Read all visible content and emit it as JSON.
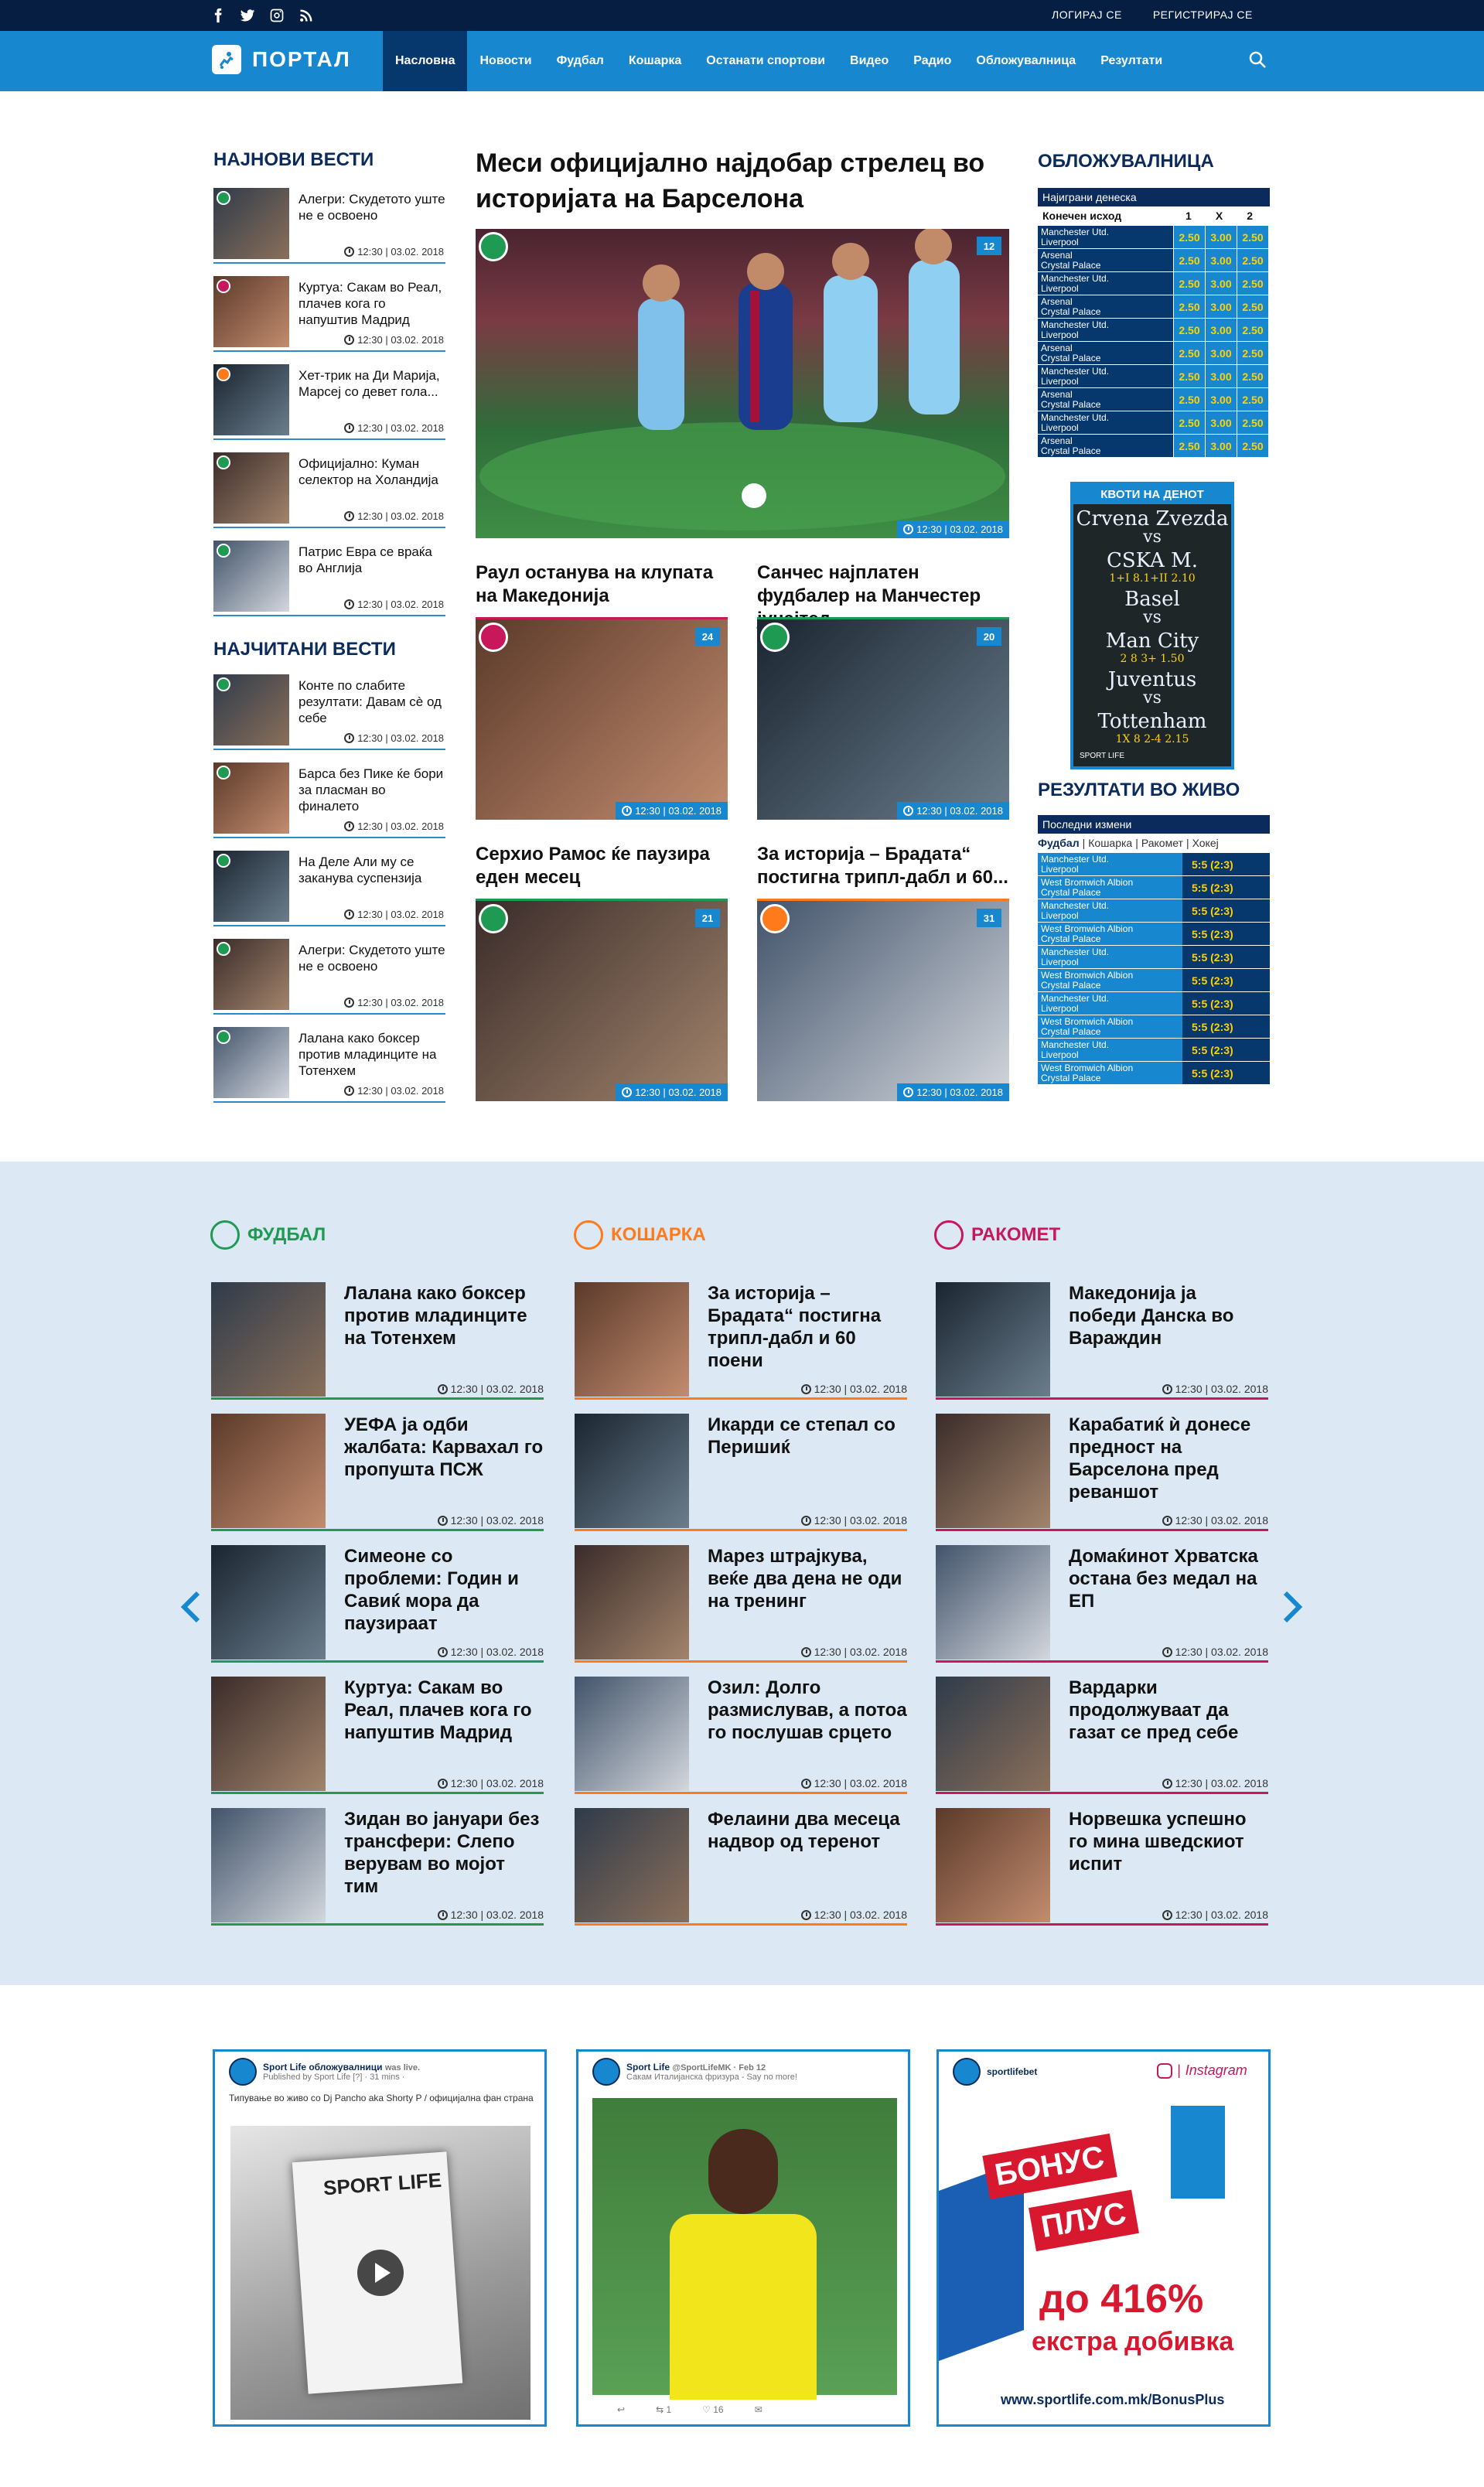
{
  "colors": {
    "navy": "#071e43",
    "brand": "#1788cf",
    "football": "#1f9a53",
    "basketball": "#ff7a1a",
    "handball": "#c8175b",
    "band": "#dce9f5"
  },
  "topbar": {
    "login": "ЛОГИРАЈ СЕ",
    "register": "РЕГИСТРИРАЈ СЕ",
    "social": [
      "facebook-icon",
      "twitter-icon",
      "instagram-icon",
      "rss-icon"
    ]
  },
  "logo": {
    "text": "ПОРТАЛ"
  },
  "nav": {
    "items": [
      "Насловна",
      "Новости",
      "Фудбал",
      "Кошарка",
      "Останати спортови",
      "Видео",
      "Радио",
      "Обложувалница",
      "Резултати"
    ]
  },
  "latest": {
    "title": "НАЈНОВИ ВЕСТИ",
    "items": [
      {
        "t": "Алегри: Скудетото уште не е  освоено",
        "meta": "12:30 | 03.02. 2018",
        "sport": "football"
      },
      {
        "t": "Куртуа: Сакам во Реал, плачев кога го напуштив Мадрид",
        "meta": "12:30 | 03.02. 2018",
        "sport": "handball"
      },
      {
        "t": "Хет-трик на Ди Марија, Марсеј со девет гола...",
        "meta": "12:30 | 03.02. 2018",
        "sport": "basketball"
      },
      {
        "t": "Официјално: Куман селектор на Холандија",
        "meta": "12:30 | 03.02. 2018",
        "sport": "football"
      },
      {
        "t": "Патрис Евра се враќа во Англија",
        "meta": "12:30 | 03.02. 2018",
        "sport": "football"
      }
    ]
  },
  "mostread": {
    "title": "НАЈЧИТАНИ ВЕСТИ",
    "items": [
      {
        "t": "Конте по слабите резултати: Давам сè од себе",
        "meta": "12:30 | 03.02. 2018",
        "sport": "football"
      },
      {
        "t": "Барса без Пике ќе бори за пласман во финалето",
        "meta": "12:30 | 03.02. 2018",
        "sport": "football"
      },
      {
        "t": "На Деле Али му се заканува суспензија",
        "meta": "12:30 | 03.02. 2018",
        "sport": "football"
      },
      {
        "t": "Алегри: Скудетото уште не е  освоено",
        "meta": "12:30 | 03.02. 2018",
        "sport": "football"
      },
      {
        "t": "Лалана како боксер против младинците на Тотенхем",
        "meta": "12:30 | 03.02. 2018",
        "sport": "football"
      }
    ]
  },
  "featured": {
    "title": "Меси официјално најдобар стрелец во историјата на Барселона",
    "num": "12",
    "meta": "12:30 | 03.02. 2018"
  },
  "cards": [
    {
      "t": "Раул останува на клупата на Македонија",
      "num": "24",
      "meta": "12:30 | 03.02. 2018",
      "sport": "handball"
    },
    {
      "t": "Санчес најплатен фудбалер на Манчестер јунајтед",
      "num": "20",
      "meta": "12:30 | 03.02. 2018",
      "sport": "football"
    },
    {
      "t": "Серхио Рамос ќе паузира еден месец",
      "num": "21",
      "meta": "12:30 | 03.02. 2018",
      "sport": "football"
    },
    {
      "t": "За историја – Брадата“ постигна трипл-дабл и 60...",
      "num": "31",
      "meta": "12:30 | 03.02. 2018",
      "sport": "basketball"
    }
  ],
  "betting": {
    "title": "ОБЛОЖУВАЛНИЦА",
    "header": "Најиграни денеска",
    "sub": "Конечен исход",
    "cols": [
      "1",
      "X",
      "2"
    ],
    "rows": [
      {
        "a": "Manchester Utd.",
        "b": "Liverpool",
        "o": [
          "2.50",
          "3.00",
          "2.50"
        ]
      },
      {
        "a": "Arsenal",
        "b": "Crystal Palace",
        "o": [
          "2.50",
          "3.00",
          "2.50"
        ]
      },
      {
        "a": "Manchester Utd.",
        "b": "Liverpool",
        "o": [
          "2.50",
          "3.00",
          "2.50"
        ]
      },
      {
        "a": "Arsenal",
        "b": "Crystal Palace",
        "o": [
          "2.50",
          "3.00",
          "2.50"
        ]
      },
      {
        "a": "Manchester Utd.",
        "b": "Liverpool",
        "o": [
          "2.50",
          "3.00",
          "2.50"
        ]
      },
      {
        "a": "Arsenal",
        "b": "Crystal Palace",
        "o": [
          "2.50",
          "3.00",
          "2.50"
        ]
      },
      {
        "a": "Manchester Utd.",
        "b": "Liverpool",
        "o": [
          "2.50",
          "3.00",
          "2.50"
        ]
      },
      {
        "a": "Arsenal",
        "b": "Crystal Palace",
        "o": [
          "2.50",
          "3.00",
          "2.50"
        ]
      },
      {
        "a": "Manchester Utd.",
        "b": "Liverpool",
        "o": [
          "2.50",
          "3.00",
          "2.50"
        ]
      },
      {
        "a": "Arsenal",
        "b": "Crystal Palace",
        "o": [
          "2.50",
          "3.00",
          "2.50"
        ]
      }
    ]
  },
  "quota": {
    "title": "КВОТИ НА ДЕНОТ",
    "matches": [
      {
        "a": "Crvena Zvezda",
        "vs": "vs",
        "b": "CSKA M.",
        "o": "1+I  8.1+II  2.10"
      },
      {
        "a": "Basel",
        "vs": "vs",
        "b": "Man City",
        "o": "2  8  3+  1.50"
      },
      {
        "a": "Juventus",
        "vs": "vs",
        "b": "Tottenham",
        "o": "1X  8  2-4  2.15"
      }
    ],
    "footer": "SPORT LIFE"
  },
  "live": {
    "title": "РЕЗУЛТАТИ ВО ЖИВО",
    "header": "Последни измени",
    "tabs": [
      "Фудбал",
      "Кошарка",
      "Ракомет",
      "Хокеј"
    ],
    "rows": [
      {
        "a": "Manchester Utd.",
        "b": "Liverpool",
        "s": "5:5 (2:3)"
      },
      {
        "a": "West Bromwich Albion",
        "b": "Crystal Palace",
        "s": "5:5 (2:3)"
      },
      {
        "a": "Manchester Utd.",
        "b": "Liverpool",
        "s": "5:5 (2:3)"
      },
      {
        "a": "West Bromwich Albion",
        "b": "Crystal Palace",
        "s": "5:5 (2:3)"
      },
      {
        "a": "Manchester Utd.",
        "b": "Liverpool",
        "s": "5:5 (2:3)"
      },
      {
        "a": "West Bromwich Albion",
        "b": "Crystal Palace",
        "s": "5:5 (2:3)"
      },
      {
        "a": "Manchester Utd.",
        "b": "Liverpool",
        "s": "5:5 (2:3)"
      },
      {
        "a": "West Bromwich Albion",
        "b": "Crystal Palace",
        "s": "5:5 (2:3)"
      },
      {
        "a": "Manchester Utd.",
        "b": "Liverpool",
        "s": "5:5 (2:3)"
      },
      {
        "a": "West Bromwich Albion",
        "b": "Crystal Palace",
        "s": "5:5 (2:3)"
      }
    ]
  },
  "columns": [
    {
      "title": "ФУДБАЛ",
      "icon": "football-icon",
      "items": [
        {
          "t": "Лалана како боксер против младинците на Тотенхем",
          "meta": "12:30 | 03.02. 2018"
        },
        {
          "t": "УЕФА ја одби жалбата: Карвахал го пропушта ПСЖ",
          "meta": "12:30 | 03.02. 2018"
        },
        {
          "t": "Симеоне со проблеми: Годин и Савиќ мора да паузираат",
          "meta": "12:30 | 03.02. 2018"
        },
        {
          "t": "Куртуа: Сакам во Реал, плачев кога го напуштив Мадрид",
          "meta": "12:30 | 03.02. 2018"
        },
        {
          "t": "Зидан во јануари без трансфери: Слепо верувам во мојот тим",
          "meta": "12:30 | 03.02. 2018"
        }
      ]
    },
    {
      "title": "КОШАРКА",
      "icon": "basketball-icon",
      "items": [
        {
          "t": "За историја – Брадата“ постигна трипл-дабл и 60 поени",
          "meta": "12:30 | 03.02. 2018"
        },
        {
          "t": "Икарди се степал со Перишиќ",
          "meta": "12:30 | 03.02. 2018"
        },
        {
          "t": "Марез штрајкува, веќе два дена не оди на тренинг",
          "meta": "12:30 | 03.02. 2018"
        },
        {
          "t": "Озил: Долго размислував, а потоа го послушав срцето",
          "meta": "12:30 | 03.02. 2018"
        },
        {
          "t": "Фелаини два месеца надвор од теренот",
          "meta": "12:30 | 03.02. 2018"
        }
      ]
    },
    {
      "title": "РАКОМЕТ",
      "icon": "handball-icon",
      "items": [
        {
          "t": "Македонија ја победи Данска во Вараждин",
          "meta": "12:30 | 03.02. 2018"
        },
        {
          "t": "Карабатиќ ѝ донесе предност на Барселона пред реваншот",
          "meta": "12:30 | 03.02. 2018"
        },
        {
          "t": "Домаќинот Хрватска остана без медал на ЕП",
          "meta": "12:30 | 03.02. 2018"
        },
        {
          "t": "Вардарки продолжуваат да газат се пред себе",
          "meta": "12:30 | 03.02. 2018"
        },
        {
          "t": "Норвешка успешно го мина шведскиот испит",
          "meta": "12:30 | 03.02. 2018"
        }
      ]
    }
  ],
  "socials": {
    "facebook": {
      "name": "Sport Life обложувалници",
      "action": "was live.",
      "sub": "Published by Sport Life [?] · 31 mins ·",
      "text": "Типување во живо со Dj Pancho aka Shorty P / официјална фан страна",
      "photo_text": "SPORT LIFE"
    },
    "twitter": {
      "name": "Sport Life",
      "handle": "@SportLifeMK · Feb 12",
      "text": "Сакам Италијанска фризура - Say no more!",
      "actions": [
        "reply-icon",
        "retweet-icon",
        "like-icon",
        "mail-icon"
      ],
      "rt": "1",
      "likes": "16"
    },
    "instagram": {
      "name": "sportlifebet",
      "brand": "Instagram",
      "promo1": "БОНУС",
      "promo2": "ПЛУС",
      "promo3": "до 416%",
      "promo4": "екстра добивка",
      "url": "www.sportlife.com.mk/BonusPlus"
    }
  }
}
